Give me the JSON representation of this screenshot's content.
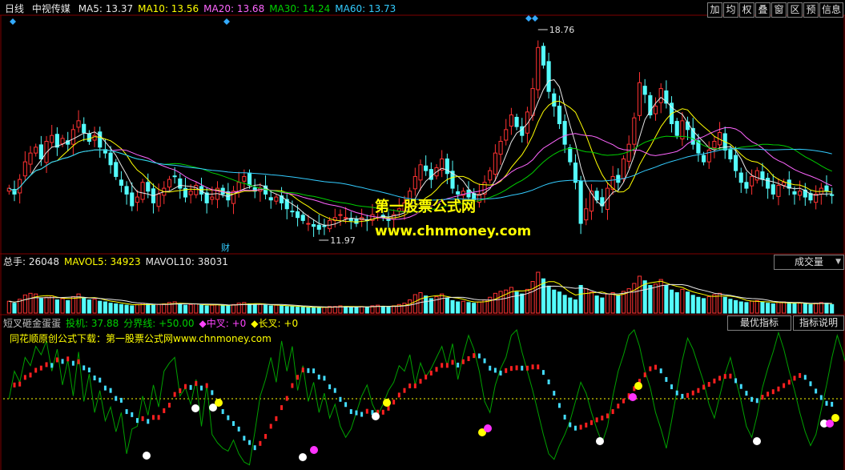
{
  "main_header": {
    "period": "日线",
    "stock_name": "中视传媒",
    "ma_values": [
      {
        "label": "MA5: 13.37",
        "color": "#e8e8e8"
      },
      {
        "label": "MA10: 13.56",
        "color": "#ffff00"
      },
      {
        "label": "MA20: 13.68",
        "color": "#ff66ff"
      },
      {
        "label": "MA30: 14.24",
        "color": "#00d000"
      },
      {
        "label": "MA60: 13.73",
        "color": "#33ccff"
      }
    ]
  },
  "toolbar": [
    "加",
    "均",
    "权",
    "叠",
    "窗",
    "区",
    "预",
    "信息"
  ],
  "price_labels": {
    "high": "18.76",
    "low": "11.97",
    "cai_marker": "财"
  },
  "watermark": {
    "title": "第一股票公式网",
    "url": "www.chnmoney.com"
  },
  "volume_header": {
    "items": [
      {
        "label": "总手: 26048",
        "color": "#e8e8e8"
      },
      {
        "label": "MAVOL5: 34923",
        "color": "#ffff00"
      },
      {
        "label": "MAVOL10: 38031",
        "color": "#e8e8e8"
      }
    ],
    "selector": "成交量"
  },
  "indicator_header": {
    "items": [
      {
        "label": "短叉砸金蛋蛋",
        "color": "#c0c0c0"
      },
      {
        "label": "投机: 37.88",
        "color": "#00d000"
      },
      {
        "label": "分界线: +50.00",
        "color": "#00d000"
      },
      {
        "label": "◆中叉: +0",
        "color": "#ff44ff"
      },
      {
        "label": "◆长叉: +0",
        "color": "#ffff00"
      }
    ],
    "subtitle": "同花顺原创公式下载：第一股票公式网www.chnmoney.com",
    "best_button": "最优指标",
    "explain_button": "指标说明"
  },
  "colors": {
    "up": "#ff3232",
    "down": "#54fcfc",
    "ma5": "#e8e8e8",
    "ma10": "#ffff00",
    "ma20": "#ff66ff",
    "ma30": "#00d000",
    "ma60": "#33ccff",
    "grid": "#800000"
  },
  "chart_data": {
    "type": "candlestick",
    "series": [
      {
        "name": "price_close",
        "values": [
          13.6,
          13.4,
          13.9,
          14.5,
          14.8,
          15.0,
          14.6,
          15.2,
          15.4,
          15.0,
          15.3,
          15.1,
          15.6,
          15.9,
          15.5,
          15.2,
          15.4,
          15.0,
          14.8,
          14.4,
          14.0,
          13.7,
          13.4,
          13.0,
          13.3,
          13.8,
          13.5,
          13.1,
          13.4,
          13.6,
          13.9,
          14.0,
          13.6,
          13.3,
          13.5,
          13.7,
          13.4,
          13.1,
          13.3,
          13.6,
          13.4,
          13.2,
          13.5,
          13.8,
          14.0,
          13.7,
          13.5,
          13.6,
          13.4,
          13.2,
          13.3,
          13.1,
          12.9,
          12.8,
          12.6,
          12.5,
          12.4,
          12.3,
          12.2,
          12.3,
          12.5,
          12.6,
          12.7,
          12.6,
          12.5,
          12.4,
          12.6,
          12.5,
          12.7,
          12.8,
          12.6,
          12.5,
          12.7,
          12.9,
          13.1,
          13.5,
          14.0,
          14.4,
          14.2,
          13.9,
          14.3,
          14.6,
          14.1,
          13.6,
          13.4,
          13.5,
          13.3,
          13.2,
          13.4,
          13.8,
          14.2,
          14.8,
          15.2,
          15.6,
          16.1,
          15.7,
          15.4,
          16.2,
          17.0,
          18.4,
          17.8,
          16.9,
          16.4,
          15.8,
          15.1,
          14.5,
          13.8,
          12.4,
          12.9,
          13.5,
          13.2,
          13.0,
          13.6,
          14.0,
          13.8,
          14.6,
          15.1,
          16.0,
          17.2,
          16.8,
          16.1,
          16.4,
          17.0,
          16.5,
          15.8,
          15.4,
          15.9,
          15.6,
          15.1,
          14.8,
          14.5,
          14.9,
          15.2,
          15.5,
          14.9,
          14.6,
          14.2,
          13.8,
          13.6,
          14.0,
          14.2,
          13.9,
          13.6,
          13.4,
          13.7,
          13.8,
          13.6,
          13.4,
          13.5,
          13.3,
          13.2,
          13.4,
          13.6,
          13.5,
          13.37
        ]
      },
      {
        "name": "volume",
        "values": [
          36,
          30,
          42,
          55,
          60,
          58,
          44,
          48,
          52,
          40,
          44,
          38,
          50,
          58,
          46,
          40,
          42,
          36,
          34,
          30,
          28,
          26,
          24,
          22,
          26,
          30,
          28,
          24,
          26,
          28,
          32,
          34,
          28,
          24,
          26,
          28,
          24,
          22,
          24,
          26,
          24,
          22,
          26,
          30,
          32,
          28,
          26,
          26,
          24,
          22,
          24,
          22,
          20,
          20,
          18,
          18,
          17,
          17,
          16,
          18,
          20,
          20,
          22,
          20,
          18,
          18,
          20,
          18,
          22,
          24,
          20,
          18,
          22,
          26,
          30,
          40,
          56,
          62,
          52,
          44,
          50,
          58,
          46,
          38,
          34,
          36,
          32,
          30,
          34,
          40,
          48,
          60,
          66,
          70,
          78,
          64,
          58,
          72,
          96,
          124,
          104,
          82,
          70,
          64,
          54,
          46,
          40,
          84,
          74,
          64,
          52,
          46,
          58,
          62,
          54,
          66,
          74,
          90,
          112,
          98,
          84,
          88,
          102,
          84,
          70,
          62,
          72,
          64,
          54,
          48,
          44,
          50,
          56,
          60,
          48,
          42,
          38,
          34,
          32,
          36,
          38,
          34,
          30,
          28,
          32,
          34,
          30,
          28,
          30,
          28,
          26,
          30,
          32,
          30,
          26
        ]
      },
      {
        "name": "投机",
        "values": [
          50,
          70,
          62,
          80,
          74,
          88,
          82,
          92,
          70,
          86,
          60,
          78,
          52,
          84,
          48,
          68,
          40,
          56,
          34,
          44,
          26,
          40,
          10,
          28,
          30,
          52,
          38,
          60,
          44,
          70,
          76,
          80,
          52,
          58,
          46,
          64,
          30,
          60,
          24,
          18,
          14,
          12,
          20,
          10,
          4,
          2,
          26,
          52,
          64,
          80,
          62,
          92,
          70,
          88,
          56,
          74,
          48,
          62,
          40,
          54,
          36,
          46,
          30,
          22,
          28,
          40,
          52,
          60,
          46,
          38,
          46,
          56,
          62,
          74,
          70,
          82,
          60,
          76,
          66,
          72,
          80,
          88,
          74,
          90,
          64,
          82,
          96,
          86,
          70,
          48,
          40,
          60,
          72,
          80,
          96,
          100,
          84,
          70,
          56,
          40,
          24,
          10,
          6,
          16,
          24,
          34,
          48,
          62,
          54,
          40,
          28,
          18,
          30,
          52,
          70,
          82,
          96,
          100,
          88,
          70,
          58,
          40,
          28,
          14,
          34,
          56,
          78,
          94,
          86,
          74,
          62,
          46,
          36,
          52,
          68,
          80,
          64,
          48,
          30,
          22,
          38,
          58,
          72,
          84,
          98,
          86,
          70,
          56,
          40,
          26,
          16,
          24,
          42,
          60,
          80,
          96,
          84,
          70,
          52,
          40,
          36
        ]
      }
    ],
    "annotations": [
      "18.76",
      "11.97"
    ],
    "ylim_price": [
      11.5,
      19.2
    ],
    "reference_line": 50
  }
}
